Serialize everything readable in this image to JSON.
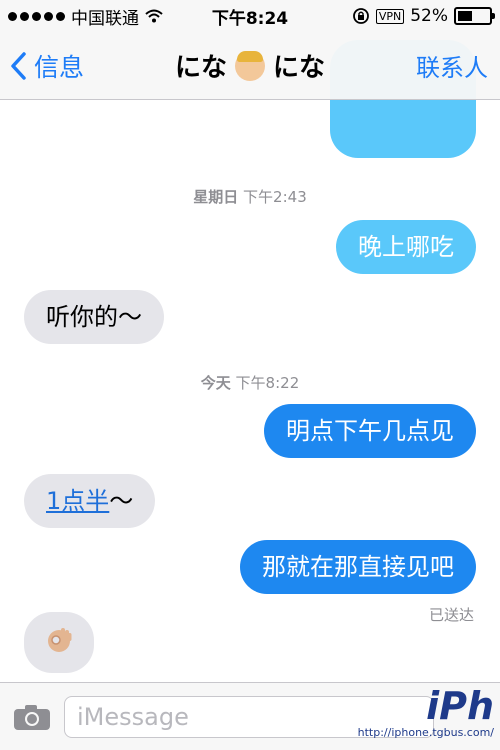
{
  "status_bar": {
    "carrier": "中国联通",
    "time": "下午8:24",
    "vpn": "VPN",
    "battery": "52%",
    "battery_level": 0.52
  },
  "nav": {
    "back_label": "信息",
    "title_left": "にな",
    "title_right": "にな",
    "contacts_label": "联系人"
  },
  "thread": {
    "timestamp_1": {
      "day": "星期日",
      "time": "下午2:43"
    },
    "msg_out_1": "晚上哪吃",
    "msg_in_1": "听你的～",
    "timestamp_2": {
      "day": "今天",
      "time": "下午8:22"
    },
    "msg_out_2": "明点下午几点见",
    "msg_in_2_link": "1点半",
    "msg_in_2_tail": "～",
    "msg_out_3": "那就在那直接见吧",
    "delivered": "已送达"
  },
  "input": {
    "placeholder": "iMessage"
  },
  "watermark": {
    "logo": "iPh",
    "url": "http://iphone.tgbus.com/"
  }
}
